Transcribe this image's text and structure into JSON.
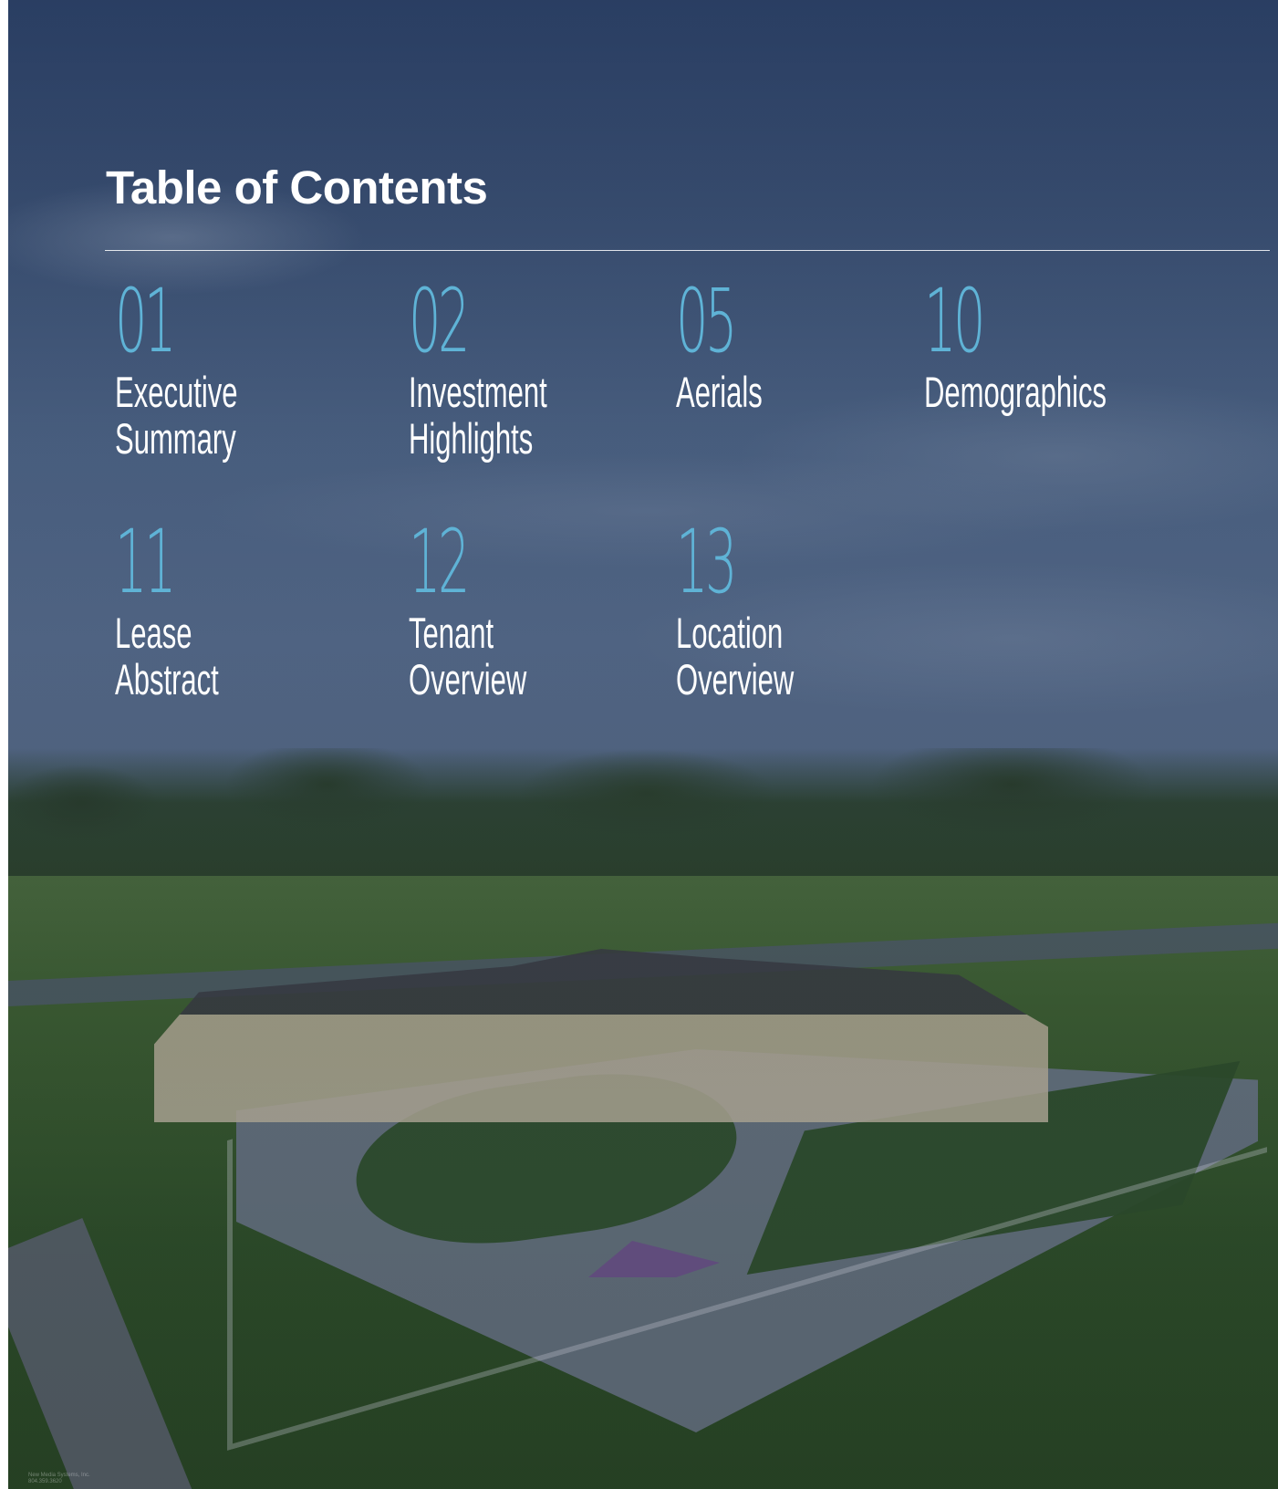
{
  "document": {
    "title": "Table of Contents",
    "sections": [
      {
        "number": "01",
        "label_line1": "Executive",
        "label_line2": "Summary"
      },
      {
        "number": "02",
        "label_line1": "Investment",
        "label_line2": "Highlights"
      },
      {
        "number": "05",
        "label_line1": "Aerials",
        "label_line2": ""
      },
      {
        "number": "10",
        "label_line1": "Demographics",
        "label_line2": ""
      },
      {
        "number": "11",
        "label_line1": "Lease",
        "label_line2": "Abstract"
      },
      {
        "number": "12",
        "label_line1": "Tenant",
        "label_line2": "Overview"
      },
      {
        "number": "13",
        "label_line1": "Location",
        "label_line2": "Overview"
      }
    ],
    "photo_credit_line1": "New Media Systems, Inc.",
    "photo_credit_line2": "804.359.3620"
  },
  "colors": {
    "accent": "#5fb3d6",
    "text": "#ffffff",
    "sky": "#3f5577",
    "grass": "#2e4c27"
  }
}
